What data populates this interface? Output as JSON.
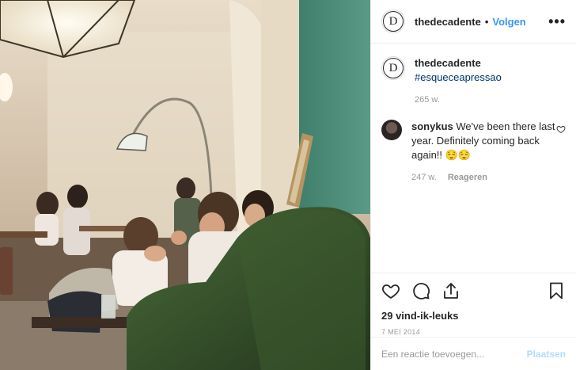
{
  "post": {
    "account": "thedecadente",
    "separator": "•",
    "follow_label": "Volgen",
    "more_label": "•••",
    "logo_letter": "D",
    "image_name": "cafe-interior-photo"
  },
  "caption": {
    "user": "thedecadente",
    "text": "#esqueceapressao",
    "age": "265 w."
  },
  "comments": [
    {
      "user": "sonykus",
      "text": "We've been there last year. Definitely coming back again!! 😌😌",
      "age": "247 w.",
      "reply_label": "Reageren"
    }
  ],
  "actions": {
    "icons": [
      "heart-icon",
      "comment-icon",
      "share-icon",
      "bookmark-icon"
    ],
    "likes": "29 vind-ik-leuks",
    "date": "7 MEI 2014"
  },
  "add_comment": {
    "placeholder": "Een reactie toevoegen...",
    "post_label": "Plaatsen"
  },
  "colors": {
    "link": "#3897f0",
    "hashtag": "#003569",
    "post_disabled": "#b3dbff",
    "wall_teal": "#4e8c7a"
  }
}
